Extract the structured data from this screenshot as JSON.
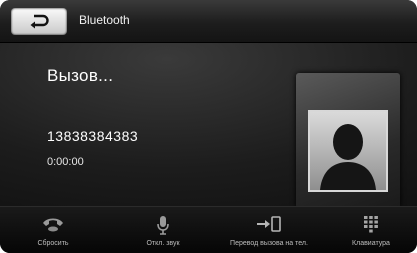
{
  "header": {
    "title": "Bluetooth",
    "back_icon": "return-arrow-icon"
  },
  "call": {
    "status": "Вызов...",
    "number": "13838384383",
    "duration": "0:00:00",
    "avatar_icon": "person-silhouette-icon"
  },
  "actions": [
    {
      "label": "Сбросить",
      "icon": "hang-up-icon"
    },
    {
      "label": "Откл. звук",
      "icon": "microphone-icon"
    },
    {
      "label": "Перевод вызова на тел.",
      "icon": "transfer-to-phone-icon"
    },
    {
      "label": "Клавиатура",
      "icon": "keypad-icon"
    }
  ],
  "colors": {
    "background": "#0b0b0b",
    "text": "#ffffff",
    "back_button": "#e8e8e8"
  }
}
